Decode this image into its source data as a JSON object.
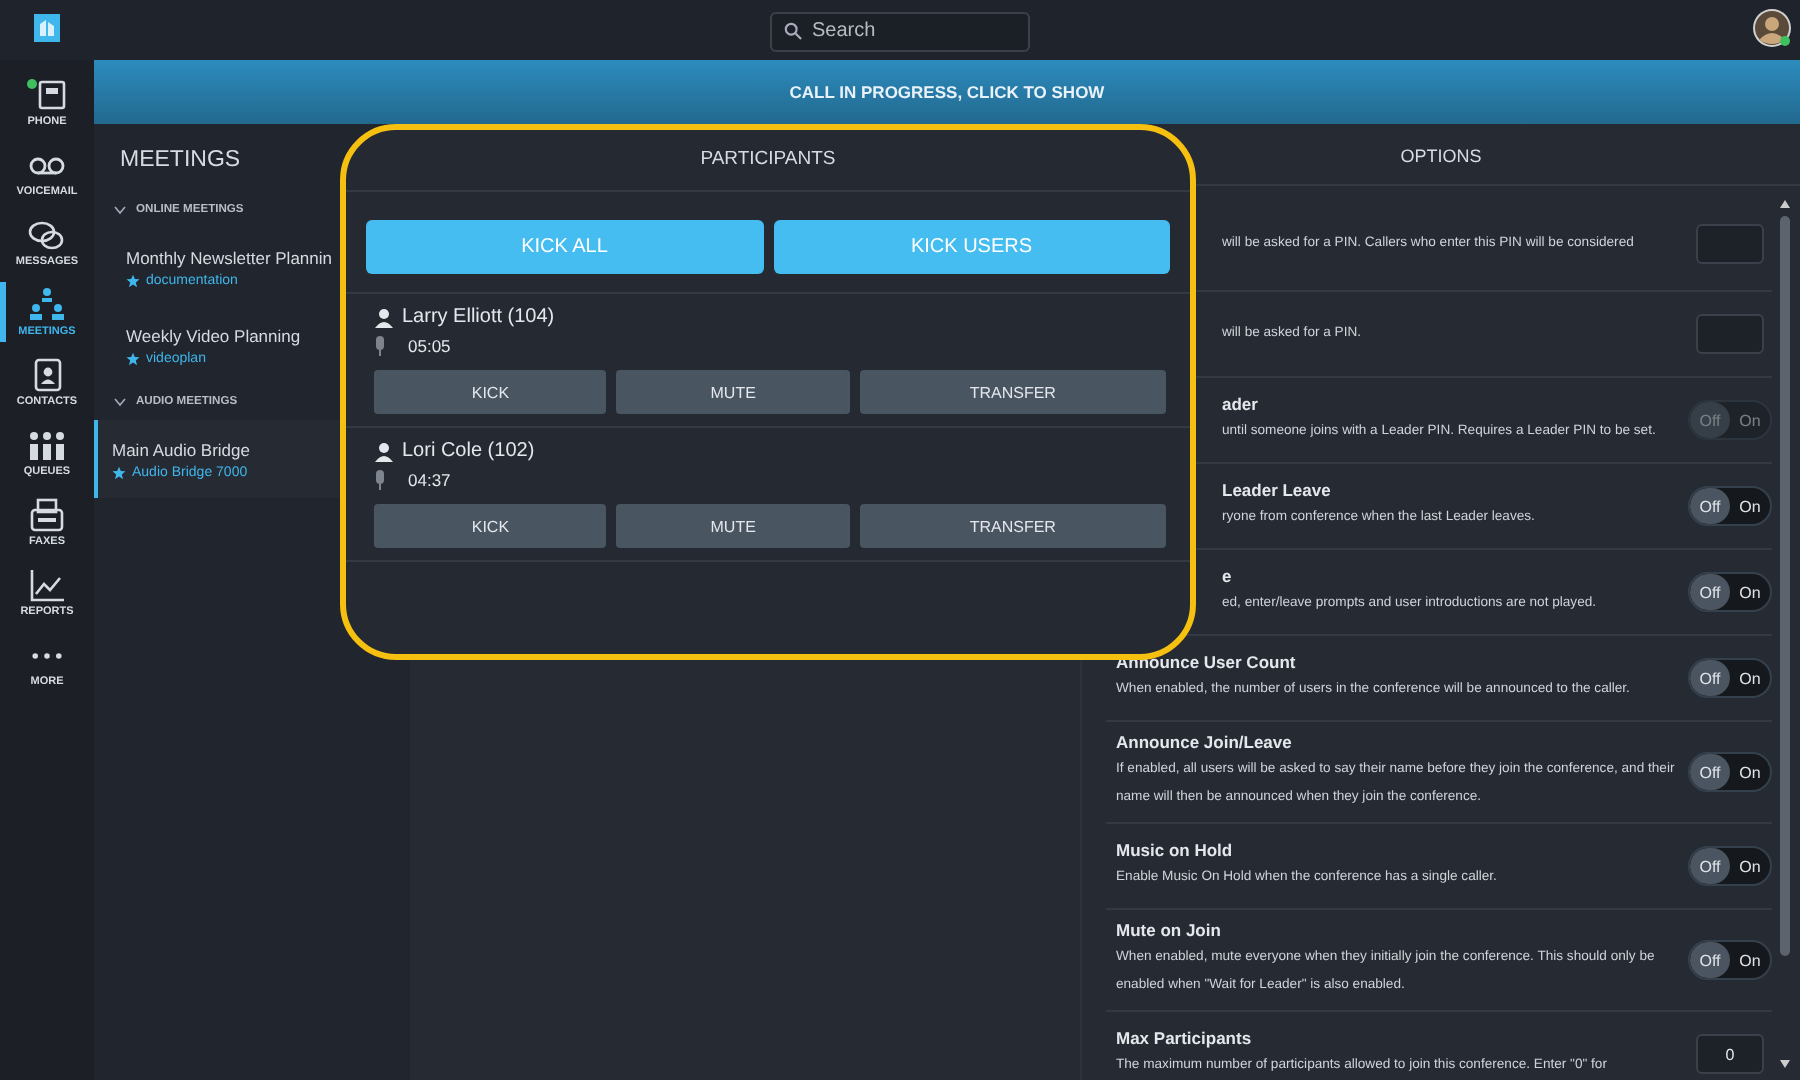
{
  "search": {
    "placeholder": "Search"
  },
  "banner": {
    "text": "CALL IN PROGRESS, CLICK TO SHOW"
  },
  "nav": [
    {
      "label": "PHONE",
      "selected": false
    },
    {
      "label": "VOICEMAIL",
      "selected": false
    },
    {
      "label": "MESSAGES",
      "selected": false
    },
    {
      "label": "MEETINGS",
      "selected": true
    },
    {
      "label": "CONTACTS",
      "selected": false
    },
    {
      "label": "QUEUES",
      "selected": false
    },
    {
      "label": "FAXES",
      "selected": false
    },
    {
      "label": "REPORTS",
      "selected": false
    },
    {
      "label": "MORE",
      "selected": false
    }
  ],
  "meetings": {
    "title": "MEETINGS",
    "sections": [
      {
        "label": "ONLINE MEETINGS",
        "expanded": true,
        "items": [
          {
            "name": "Monthly Newsletter Plannin",
            "tag": "documentation",
            "selected": false
          },
          {
            "name": "Weekly Video Planning",
            "tag": "videoplan",
            "selected": false
          }
        ]
      },
      {
        "label": "AUDIO MEETINGS",
        "expanded": true,
        "items": [
          {
            "name": "Main Audio Bridge",
            "tag": "Audio Bridge 7000",
            "selected": true
          }
        ]
      }
    ]
  },
  "participants": {
    "title": "PARTICIPANTS",
    "actions": [
      "KICK ALL",
      "KICK USERS"
    ],
    "people": [
      {
        "name": "Larry Elliott (104)",
        "time": "05:05",
        "buttons": [
          "KICK",
          "MUTE",
          "TRANSFER"
        ]
      },
      {
        "name": "Lori Cole (102)",
        "time": "04:37",
        "buttons": [
          "KICK",
          "MUTE",
          "TRANSFER"
        ]
      }
    ]
  },
  "options": {
    "title": "OPTIONS",
    "covered_rows": [
      {
        "kind": "input",
        "description": "will be asked for a PIN. Callers who enter this PIN will be considered"
      },
      {
        "kind": "input",
        "description": "will be asked for a PIN."
      },
      {
        "kind": "toggle",
        "title": "ader",
        "description": "until someone joins with a Leader PIN. Requires a Leader PIN to be set.",
        "on": false,
        "disabled": true,
        "labels": [
          "Off",
          "On"
        ]
      },
      {
        "kind": "toggle",
        "title": "Leader Leave",
        "description": "ryone from conference when the last Leader leaves.",
        "on": false,
        "disabled": false,
        "labels": [
          "Off",
          "On"
        ]
      },
      {
        "kind": "toggle",
        "title": "e",
        "description": "ed, enter/leave prompts and user introductions are not played.",
        "on": false,
        "disabled": false,
        "labels": [
          "Off",
          "On"
        ]
      }
    ],
    "rows": [
      {
        "kind": "toggle",
        "title": "Announce User Count",
        "description": "When enabled, the number of users in the conference will be announced to the caller.",
        "on": false,
        "disabled": false,
        "labels": [
          "Off",
          "On"
        ]
      },
      {
        "kind": "toggle",
        "title": "Announce Join/Leave",
        "description": "If enabled, all users will be asked to say their name before they join the conference, and their name will then be announced when they join the conference.",
        "on": false,
        "disabled": false,
        "labels": [
          "Off",
          "On"
        ]
      },
      {
        "kind": "toggle",
        "title": "Music on Hold",
        "description": "Enable Music On Hold when the conference has a single caller.",
        "on": false,
        "disabled": false,
        "labels": [
          "Off",
          "On"
        ]
      },
      {
        "kind": "toggle",
        "title": "Mute on Join",
        "description": "When enabled, mute everyone when they initially join the conference. This should only be enabled when \"Wait for Leader\" is also enabled.",
        "on": false,
        "disabled": false,
        "labels": [
          "Off",
          "On"
        ]
      },
      {
        "kind": "input",
        "title": "Max Participants",
        "description": "The maximum number of participants allowed to join this conference. Enter \"0\" for",
        "value": "0"
      }
    ]
  }
}
